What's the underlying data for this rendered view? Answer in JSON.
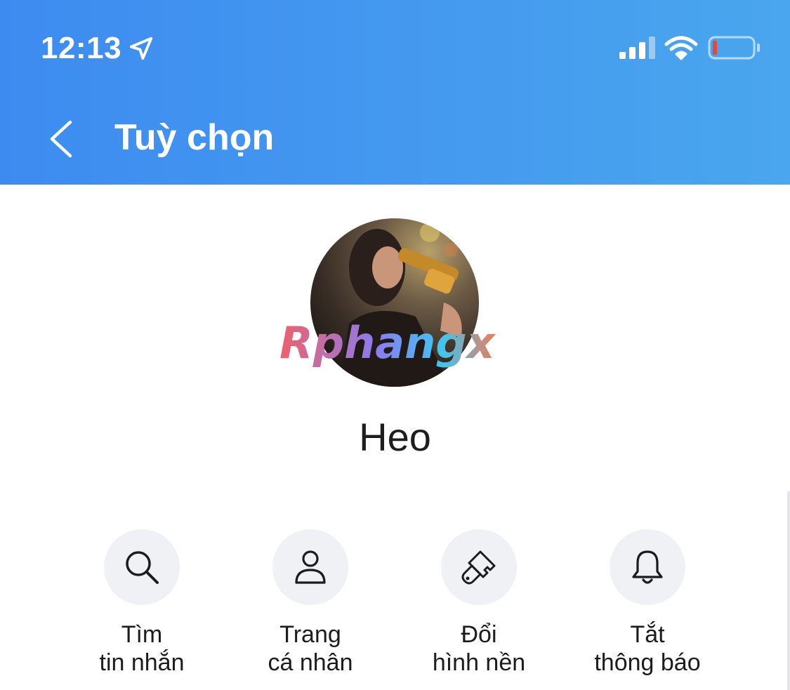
{
  "status_bar": {
    "time": "12:13",
    "icons": [
      "location-arrow-icon",
      "cellular-signal-icon",
      "wifi-icon",
      "battery-low-icon"
    ],
    "battery_level": 0.1
  },
  "header": {
    "title": "Tuỳ chọn",
    "back_icon": "chevron-left-icon",
    "background_colors": [
      "#3d8bf0",
      "#4aa6ee"
    ]
  },
  "profile": {
    "name": "Heo",
    "watermark": "Rphangx"
  },
  "actions": [
    {
      "icon": "search-icon",
      "label_line1": "Tìm",
      "label_line2": "tin nhắn"
    },
    {
      "icon": "user-icon",
      "label_line1": "Trang",
      "label_line2": "cá nhân"
    },
    {
      "icon": "paintbrush-icon",
      "label_line1": "Đổi",
      "label_line2": "hình nền"
    },
    {
      "icon": "bell-icon",
      "label_line1": "Tắt",
      "label_line2": "thông báo"
    }
  ]
}
